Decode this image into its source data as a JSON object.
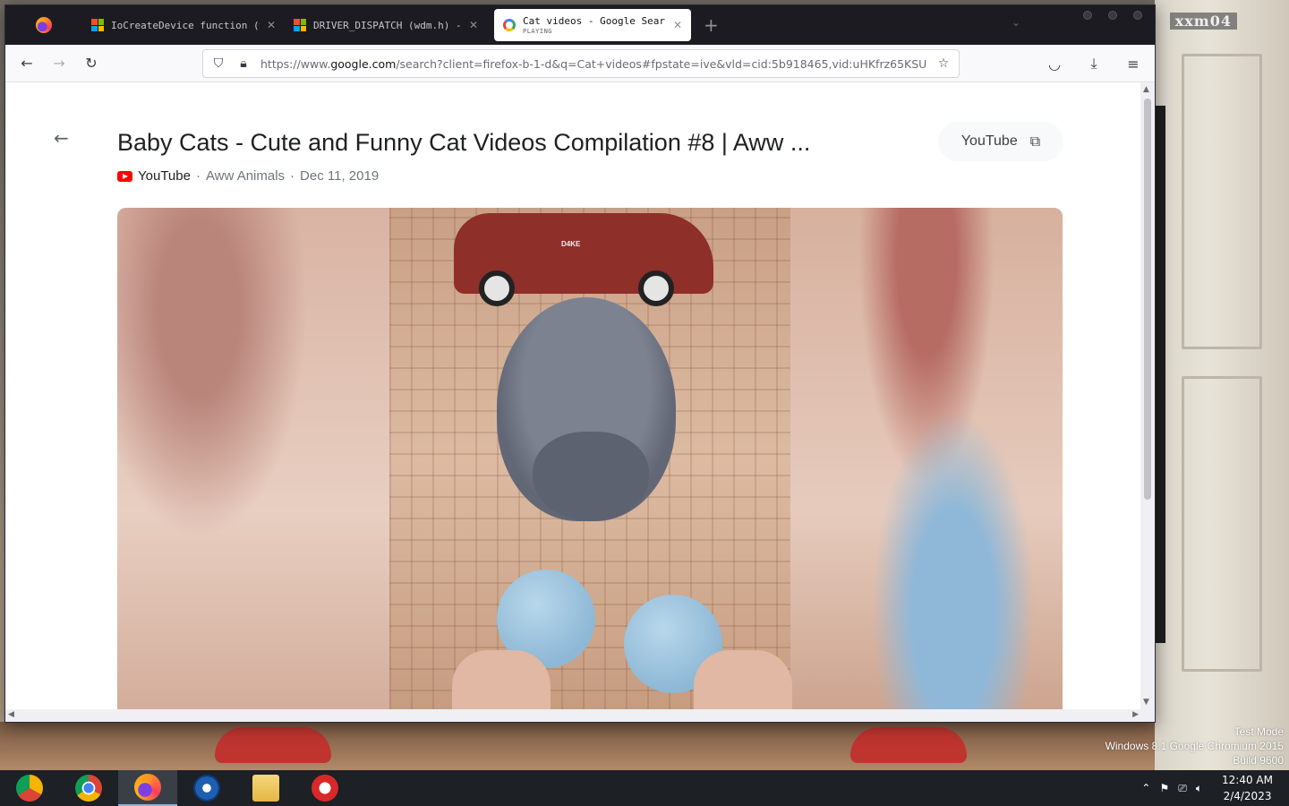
{
  "desktop": {
    "label": "xxm04",
    "watermark": [
      "Test Mode",
      "Windows 8.1 Google Chromium 2015",
      "Build 9600"
    ]
  },
  "browser": {
    "tabs": [
      {
        "title": "IoCreateDevice function (wdm.h",
        "icon": "microsoft-logo",
        "active": false
      },
      {
        "title": "DRIVER_DISPATCH (wdm.h) - \\",
        "icon": "microsoft-logo",
        "active": false
      },
      {
        "title": "Cat videos - Google Search",
        "subtitle": "PLAYING",
        "icon": "google-logo",
        "active": true
      }
    ],
    "new_tab_label": "+",
    "url_prefix": "https://www.",
    "url_domain": "google.com",
    "url_rest": "/search?client=firefox-b-1-d&q=Cat+videos#fpstate=ive&vld=cid:5b918465,vid:uHKfrz65KSU"
  },
  "video": {
    "title": "Baby Cats - Cute and Funny Cat Videos Compilation #8 | Aww ...",
    "source": "YouTube",
    "channel": "Aww Animals",
    "date": "Dec 11, 2019",
    "open_button_label": "YouTube",
    "car_text": "D4KE"
  },
  "taskbar": {
    "apps": [
      "chrome-canary",
      "chrome",
      "firefox",
      "internet-explorer",
      "file-explorer",
      "bug-tool"
    ],
    "active_app": "firefox",
    "time": "12:40 AM",
    "date": "2/4/2023"
  },
  "colors": {
    "accent_youtube": "#ff0000",
    "tabbar_bg": "#1c1b22",
    "taskbar_bg": "#1d2024"
  }
}
